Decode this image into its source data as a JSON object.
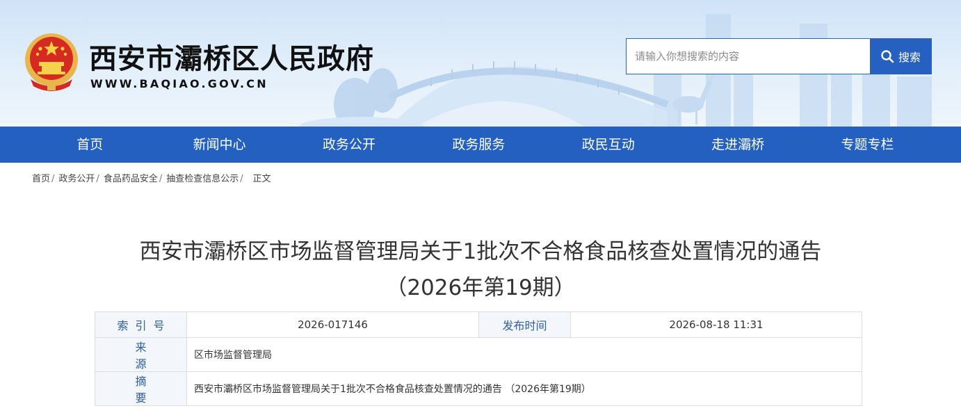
{
  "site": {
    "title": "西安市灞桥区人民政府",
    "url": "WWW.BAQIAO.GOV.CN"
  },
  "search": {
    "placeholder": "请输入你想搜索的内容",
    "button_label": "搜索",
    "button_icon": "search-icon"
  },
  "nav": {
    "items": [
      "首页",
      "新闻中心",
      "政务公开",
      "政务服务",
      "政民互动",
      "走进灞桥",
      "专题专栏"
    ]
  },
  "breadcrumb": {
    "items": [
      "首页",
      "政务公开",
      "食品药品安全",
      "抽查检查信息公示"
    ],
    "separator": "/",
    "current": "正文"
  },
  "article": {
    "title_line1": "西安市灞桥区市场监督管理局关于1批次不合格食品核查处置情况的通告",
    "title_line2": "（2026年第19期）"
  },
  "meta": {
    "index_label": "索引号",
    "index_value": "2026-017146",
    "date_label": "发布时间",
    "date_value": "2026-08-18 11:31",
    "source_label": "来源",
    "source_value": "区市场监督管理局",
    "summary_label": "摘要",
    "summary_value": "西安市灞桥区市场监督管理局关于1批次不合格食品核查处置情况的通告 （2026年第19期）"
  },
  "colors": {
    "nav_bg": "#2360c0",
    "search_button": "#2660c0",
    "label_text": "#2d5fa8",
    "emblem_red": "#d42a1f",
    "emblem_gold": "#e8b64a"
  }
}
